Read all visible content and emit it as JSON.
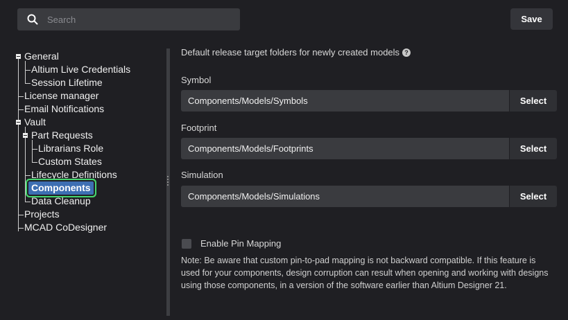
{
  "search": {
    "placeholder": "Search"
  },
  "toolbar": {
    "save_label": "Save"
  },
  "tree": {
    "general": "General",
    "altium_live": "Altium Live Credentials",
    "session_lifetime": "Session Lifetime",
    "license_manager": "License manager",
    "email_notifications": "Email Notifications",
    "vault": "Vault",
    "part_requests": "Part Requests",
    "librarians_role": "Librarians Role",
    "custom_states": "Custom States",
    "lifecycle_definitions": "Lifecycle Definitions",
    "components": "Components",
    "data_cleanup": "Data Cleanup",
    "projects": "Projects",
    "mcad_codesigner": "MCAD CoDesigner"
  },
  "panel": {
    "description": "Default release target folders for newly created models",
    "help_icon": "?",
    "symbol_label": "Symbol",
    "symbol_value": "Components/Models/Symbols",
    "footprint_label": "Footprint",
    "footprint_value": "Components/Models/Footprints",
    "simulation_label": "Simulation",
    "simulation_value": "Components/Models/Simulations",
    "select_label": "Select",
    "pin_mapping_label": "Enable Pin Mapping",
    "pin_mapping_checked": false,
    "note": "Note: Be aware that custom pin-to-pad mapping is not backward compatible. If this feature is used for your components, design corruption can result when opening and working with designs using those components, in a version of the software earlier than Altium Designer 21."
  }
}
